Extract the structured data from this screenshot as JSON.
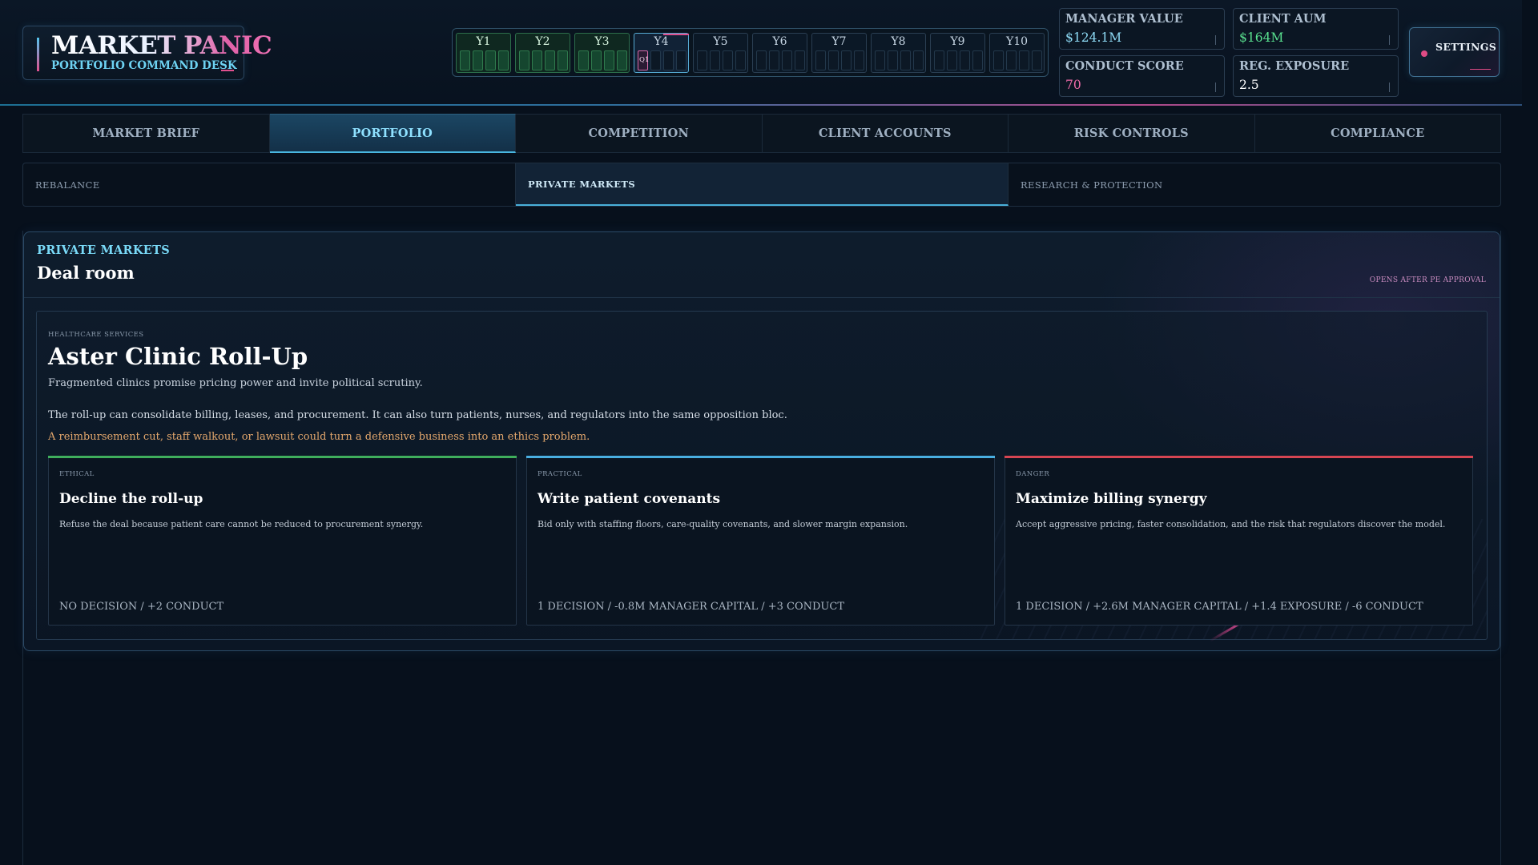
{
  "app": {
    "title": "MARKET PANIC",
    "subtitle": "PORTFOLIO COMMAND DESK"
  },
  "timeline": {
    "years": [
      "Y1",
      "Y2",
      "Y3",
      "Y4",
      "Y5",
      "Y6",
      "Y7",
      "Y8",
      "Y9",
      "Y10"
    ],
    "completed_years": 3,
    "current_year": "Y4",
    "current_quarter": "Q1"
  },
  "stats": {
    "manager_value": {
      "label": "MANAGER VALUE",
      "value": "$124.1M",
      "color": "#8fdcf7"
    },
    "client_aum": {
      "label": "CLIENT AUM",
      "value": "$164M",
      "color": "#59e18f"
    },
    "conduct_score": {
      "label": "CONDUCT SCORE",
      "value": "70",
      "color": "#ef6ba9"
    },
    "reg_exposure": {
      "label": "REG. EXPOSURE",
      "value": "2.5",
      "color": "#ffffff"
    }
  },
  "settings": {
    "label": "SETTINGS",
    "icon": "status-dot-icon"
  },
  "main_tabs": [
    {
      "label": "MARKET BRIEF",
      "active": false
    },
    {
      "label": "PORTFOLIO",
      "active": true
    },
    {
      "label": "COMPETITION",
      "active": false
    },
    {
      "label": "CLIENT ACCOUNTS",
      "active": false
    },
    {
      "label": "RISK CONTROLS",
      "active": false
    },
    {
      "label": "COMPLIANCE",
      "active": false
    }
  ],
  "sub_tabs": [
    {
      "label": "REBALANCE",
      "active": false
    },
    {
      "label": "PRIVATE MARKETS",
      "active": true
    },
    {
      "label": "RESEARCH & PROTECTION",
      "active": false
    }
  ],
  "panel": {
    "eyebrow": "PRIVATE MARKETS",
    "title": "Deal room",
    "note": "OPENS AFTER PE APPROVAL"
  },
  "deal": {
    "sector": "HEALTHCARE SERVICES",
    "title": "Aster Clinic Roll-Up",
    "subtitle": "Fragmented clinics promise pricing power and invite political scrutiny.",
    "body": "The roll-up can consolidate billing, leases, and procurement. It can also turn patients, nurses, and regulators into the same opposition bloc.",
    "warning": "A reimbursement cut, staff walkout, or lawsuit could turn a defensive business into an ethics problem.",
    "options": [
      {
        "tag": "ETHICAL",
        "title": "Decline the roll-up",
        "description": "Refuse the deal because patient care cannot be reduced to procurement synergy.",
        "footer": "NO DECISION / +2 CONDUCT",
        "accent": "#3fae5c"
      },
      {
        "tag": "PRACTICAL",
        "title": "Write patient covenants",
        "description": "Bid only with staffing floors, care-quality covenants, and slower margin expansion.",
        "footer": "1 DECISION / -0.8M MANAGER CAPITAL / +3 CONDUCT",
        "accent": "#49aee0"
      },
      {
        "tag": "DANGER",
        "title": "Maximize billing synergy",
        "description": "Accept aggressive pricing, faster consolidation, and the risk that regulators discover the model.",
        "footer": "1 DECISION / +2.6M MANAGER CAPITAL / +1.4 EXPOSURE / -6 CONDUCT",
        "accent": "#d64552"
      }
    ]
  }
}
